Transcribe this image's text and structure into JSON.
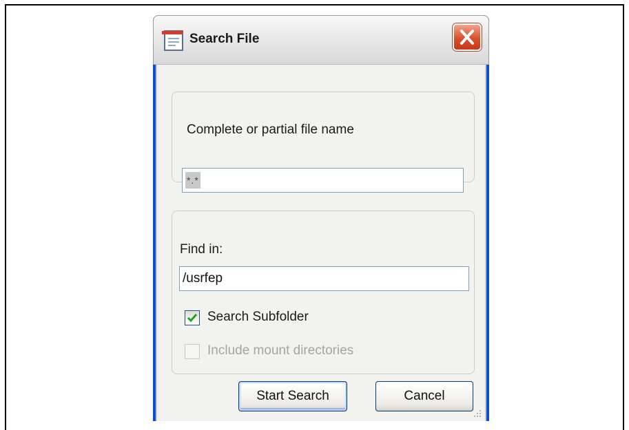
{
  "window": {
    "title": "Search File",
    "close_icon": "close-icon",
    "app_icon": "document-window-icon"
  },
  "file_group": {
    "label": "Complete or partial file name",
    "value": "*.*"
  },
  "find_group": {
    "label": "Find in:",
    "value": "/usrfep",
    "subfolder_label": "Search Subfolder",
    "subfolder_checked": true,
    "mount_label": "Include mount directories",
    "mount_checked": false,
    "mount_enabled": false
  },
  "buttons": {
    "start": "Start Search",
    "cancel": "Cancel"
  },
  "colors": {
    "titlebar": "#e6e6e6",
    "close": "#d9502d",
    "check": "#21a121",
    "disabled_text": "#a4a4a0"
  }
}
